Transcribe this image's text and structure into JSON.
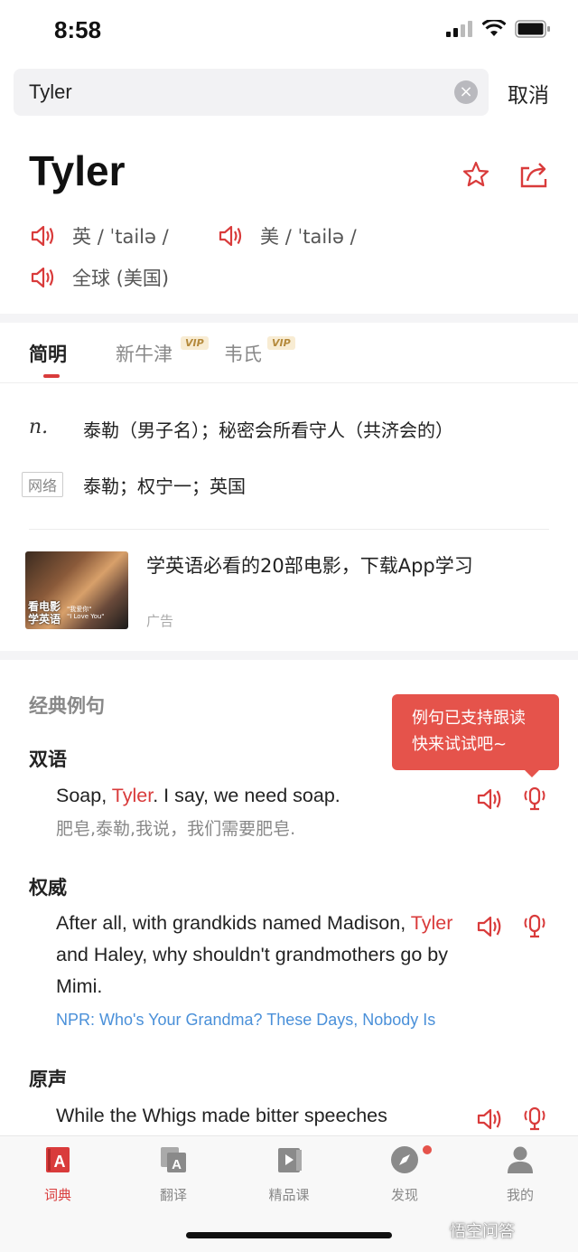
{
  "status_bar": {
    "time": "8:58"
  },
  "search": {
    "query": "Tyler",
    "cancel_label": "取消"
  },
  "word": {
    "title": "Tyler",
    "phonetics": [
      {
        "region": "英",
        "ipa": "/ ˈtailə /"
      },
      {
        "region": "美",
        "ipa": "/ ˈtailə /"
      },
      {
        "region": "全球 (美国)",
        "ipa": ""
      }
    ]
  },
  "tabs": [
    {
      "label": "简明",
      "vip": ""
    },
    {
      "label": "新牛津",
      "vip": "VIP"
    },
    {
      "label": "韦氏",
      "vip": "VIP"
    }
  ],
  "definitions": {
    "pos": "n.",
    "meaning": "泰勒（男子名）；秘密会所看守人（共济会的）",
    "net_tag": "网络",
    "net_meaning": "泰勒；权宁一；英国"
  },
  "ad": {
    "image_caption_line1": "看电影",
    "image_caption_line2": "学英语",
    "image_mini_line1": "\"我爱你\"",
    "image_mini_line2": "\"I Love You\"",
    "title": "学英语必看的20部电影，下载App学习",
    "label": "广告"
  },
  "examples": {
    "section_title": "经典例句",
    "tooltip_line1": "例句已支持跟读",
    "tooltip_line2": "快来试试吧~",
    "bilingual": {
      "label": "双语",
      "en_before": "Soap, ",
      "en_hl": "Tyler",
      "en_after": ". I say, we need soap.",
      "cn": "肥皂,泰勒,我说，我们需要肥皂."
    },
    "authority": {
      "label": "权威",
      "en_before": "After all, with grandkids named Madison, ",
      "en_hl": "Tyler",
      "en_after": " and Haley, why shouldn't grandmothers go by Mimi.",
      "source": "NPR: Who's Your Grandma? These Days, Nobody Is"
    },
    "original": {
      "label": "原声",
      "en": "While the Whigs made bitter speeches"
    }
  },
  "bottom_nav": [
    {
      "label": "词典",
      "icon": "dictionary-icon"
    },
    {
      "label": "翻译",
      "icon": "translate-icon"
    },
    {
      "label": "精品课",
      "icon": "course-icon"
    },
    {
      "label": "发现",
      "icon": "compass-icon"
    },
    {
      "label": "我的",
      "icon": "profile-icon"
    }
  ],
  "watermark": "悟空问答",
  "colors": {
    "accent": "#d93b3b",
    "link": "#4a90d9",
    "tooltip": "#e5534b"
  }
}
